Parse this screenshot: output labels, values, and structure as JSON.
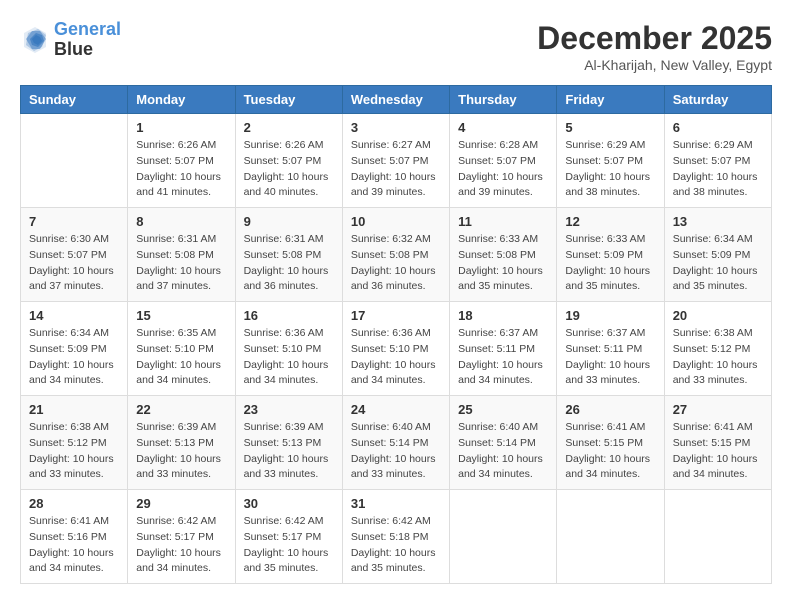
{
  "logo": {
    "line1": "General",
    "line2": "Blue"
  },
  "title": "December 2025",
  "location": "Al-Kharijah, New Valley, Egypt",
  "weekdays": [
    "Sunday",
    "Monday",
    "Tuesday",
    "Wednesday",
    "Thursday",
    "Friday",
    "Saturday"
  ],
  "weeks": [
    [
      {
        "day": "",
        "sunrise": "",
        "sunset": "",
        "daylight": ""
      },
      {
        "day": "1",
        "sunrise": "Sunrise: 6:26 AM",
        "sunset": "Sunset: 5:07 PM",
        "daylight": "Daylight: 10 hours and 41 minutes."
      },
      {
        "day": "2",
        "sunrise": "Sunrise: 6:26 AM",
        "sunset": "Sunset: 5:07 PM",
        "daylight": "Daylight: 10 hours and 40 minutes."
      },
      {
        "day": "3",
        "sunrise": "Sunrise: 6:27 AM",
        "sunset": "Sunset: 5:07 PM",
        "daylight": "Daylight: 10 hours and 39 minutes."
      },
      {
        "day": "4",
        "sunrise": "Sunrise: 6:28 AM",
        "sunset": "Sunset: 5:07 PM",
        "daylight": "Daylight: 10 hours and 39 minutes."
      },
      {
        "day": "5",
        "sunrise": "Sunrise: 6:29 AM",
        "sunset": "Sunset: 5:07 PM",
        "daylight": "Daylight: 10 hours and 38 minutes."
      },
      {
        "day": "6",
        "sunrise": "Sunrise: 6:29 AM",
        "sunset": "Sunset: 5:07 PM",
        "daylight": "Daylight: 10 hours and 38 minutes."
      }
    ],
    [
      {
        "day": "7",
        "sunrise": "Sunrise: 6:30 AM",
        "sunset": "Sunset: 5:07 PM",
        "daylight": "Daylight: 10 hours and 37 minutes."
      },
      {
        "day": "8",
        "sunrise": "Sunrise: 6:31 AM",
        "sunset": "Sunset: 5:08 PM",
        "daylight": "Daylight: 10 hours and 37 minutes."
      },
      {
        "day": "9",
        "sunrise": "Sunrise: 6:31 AM",
        "sunset": "Sunset: 5:08 PM",
        "daylight": "Daylight: 10 hours and 36 minutes."
      },
      {
        "day": "10",
        "sunrise": "Sunrise: 6:32 AM",
        "sunset": "Sunset: 5:08 PM",
        "daylight": "Daylight: 10 hours and 36 minutes."
      },
      {
        "day": "11",
        "sunrise": "Sunrise: 6:33 AM",
        "sunset": "Sunset: 5:08 PM",
        "daylight": "Daylight: 10 hours and 35 minutes."
      },
      {
        "day": "12",
        "sunrise": "Sunrise: 6:33 AM",
        "sunset": "Sunset: 5:09 PM",
        "daylight": "Daylight: 10 hours and 35 minutes."
      },
      {
        "day": "13",
        "sunrise": "Sunrise: 6:34 AM",
        "sunset": "Sunset: 5:09 PM",
        "daylight": "Daylight: 10 hours and 35 minutes."
      }
    ],
    [
      {
        "day": "14",
        "sunrise": "Sunrise: 6:34 AM",
        "sunset": "Sunset: 5:09 PM",
        "daylight": "Daylight: 10 hours and 34 minutes."
      },
      {
        "day": "15",
        "sunrise": "Sunrise: 6:35 AM",
        "sunset": "Sunset: 5:10 PM",
        "daylight": "Daylight: 10 hours and 34 minutes."
      },
      {
        "day": "16",
        "sunrise": "Sunrise: 6:36 AM",
        "sunset": "Sunset: 5:10 PM",
        "daylight": "Daylight: 10 hours and 34 minutes."
      },
      {
        "day": "17",
        "sunrise": "Sunrise: 6:36 AM",
        "sunset": "Sunset: 5:10 PM",
        "daylight": "Daylight: 10 hours and 34 minutes."
      },
      {
        "day": "18",
        "sunrise": "Sunrise: 6:37 AM",
        "sunset": "Sunset: 5:11 PM",
        "daylight": "Daylight: 10 hours and 34 minutes."
      },
      {
        "day": "19",
        "sunrise": "Sunrise: 6:37 AM",
        "sunset": "Sunset: 5:11 PM",
        "daylight": "Daylight: 10 hours and 33 minutes."
      },
      {
        "day": "20",
        "sunrise": "Sunrise: 6:38 AM",
        "sunset": "Sunset: 5:12 PM",
        "daylight": "Daylight: 10 hours and 33 minutes."
      }
    ],
    [
      {
        "day": "21",
        "sunrise": "Sunrise: 6:38 AM",
        "sunset": "Sunset: 5:12 PM",
        "daylight": "Daylight: 10 hours and 33 minutes."
      },
      {
        "day": "22",
        "sunrise": "Sunrise: 6:39 AM",
        "sunset": "Sunset: 5:13 PM",
        "daylight": "Daylight: 10 hours and 33 minutes."
      },
      {
        "day": "23",
        "sunrise": "Sunrise: 6:39 AM",
        "sunset": "Sunset: 5:13 PM",
        "daylight": "Daylight: 10 hours and 33 minutes."
      },
      {
        "day": "24",
        "sunrise": "Sunrise: 6:40 AM",
        "sunset": "Sunset: 5:14 PM",
        "daylight": "Daylight: 10 hours and 33 minutes."
      },
      {
        "day": "25",
        "sunrise": "Sunrise: 6:40 AM",
        "sunset": "Sunset: 5:14 PM",
        "daylight": "Daylight: 10 hours and 34 minutes."
      },
      {
        "day": "26",
        "sunrise": "Sunrise: 6:41 AM",
        "sunset": "Sunset: 5:15 PM",
        "daylight": "Daylight: 10 hours and 34 minutes."
      },
      {
        "day": "27",
        "sunrise": "Sunrise: 6:41 AM",
        "sunset": "Sunset: 5:15 PM",
        "daylight": "Daylight: 10 hours and 34 minutes."
      }
    ],
    [
      {
        "day": "28",
        "sunrise": "Sunrise: 6:41 AM",
        "sunset": "Sunset: 5:16 PM",
        "daylight": "Daylight: 10 hours and 34 minutes."
      },
      {
        "day": "29",
        "sunrise": "Sunrise: 6:42 AM",
        "sunset": "Sunset: 5:17 PM",
        "daylight": "Daylight: 10 hours and 34 minutes."
      },
      {
        "day": "30",
        "sunrise": "Sunrise: 6:42 AM",
        "sunset": "Sunset: 5:17 PM",
        "daylight": "Daylight: 10 hours and 35 minutes."
      },
      {
        "day": "31",
        "sunrise": "Sunrise: 6:42 AM",
        "sunset": "Sunset: 5:18 PM",
        "daylight": "Daylight: 10 hours and 35 minutes."
      },
      {
        "day": "",
        "sunrise": "",
        "sunset": "",
        "daylight": ""
      },
      {
        "day": "",
        "sunrise": "",
        "sunset": "",
        "daylight": ""
      },
      {
        "day": "",
        "sunrise": "",
        "sunset": "",
        "daylight": ""
      }
    ]
  ]
}
